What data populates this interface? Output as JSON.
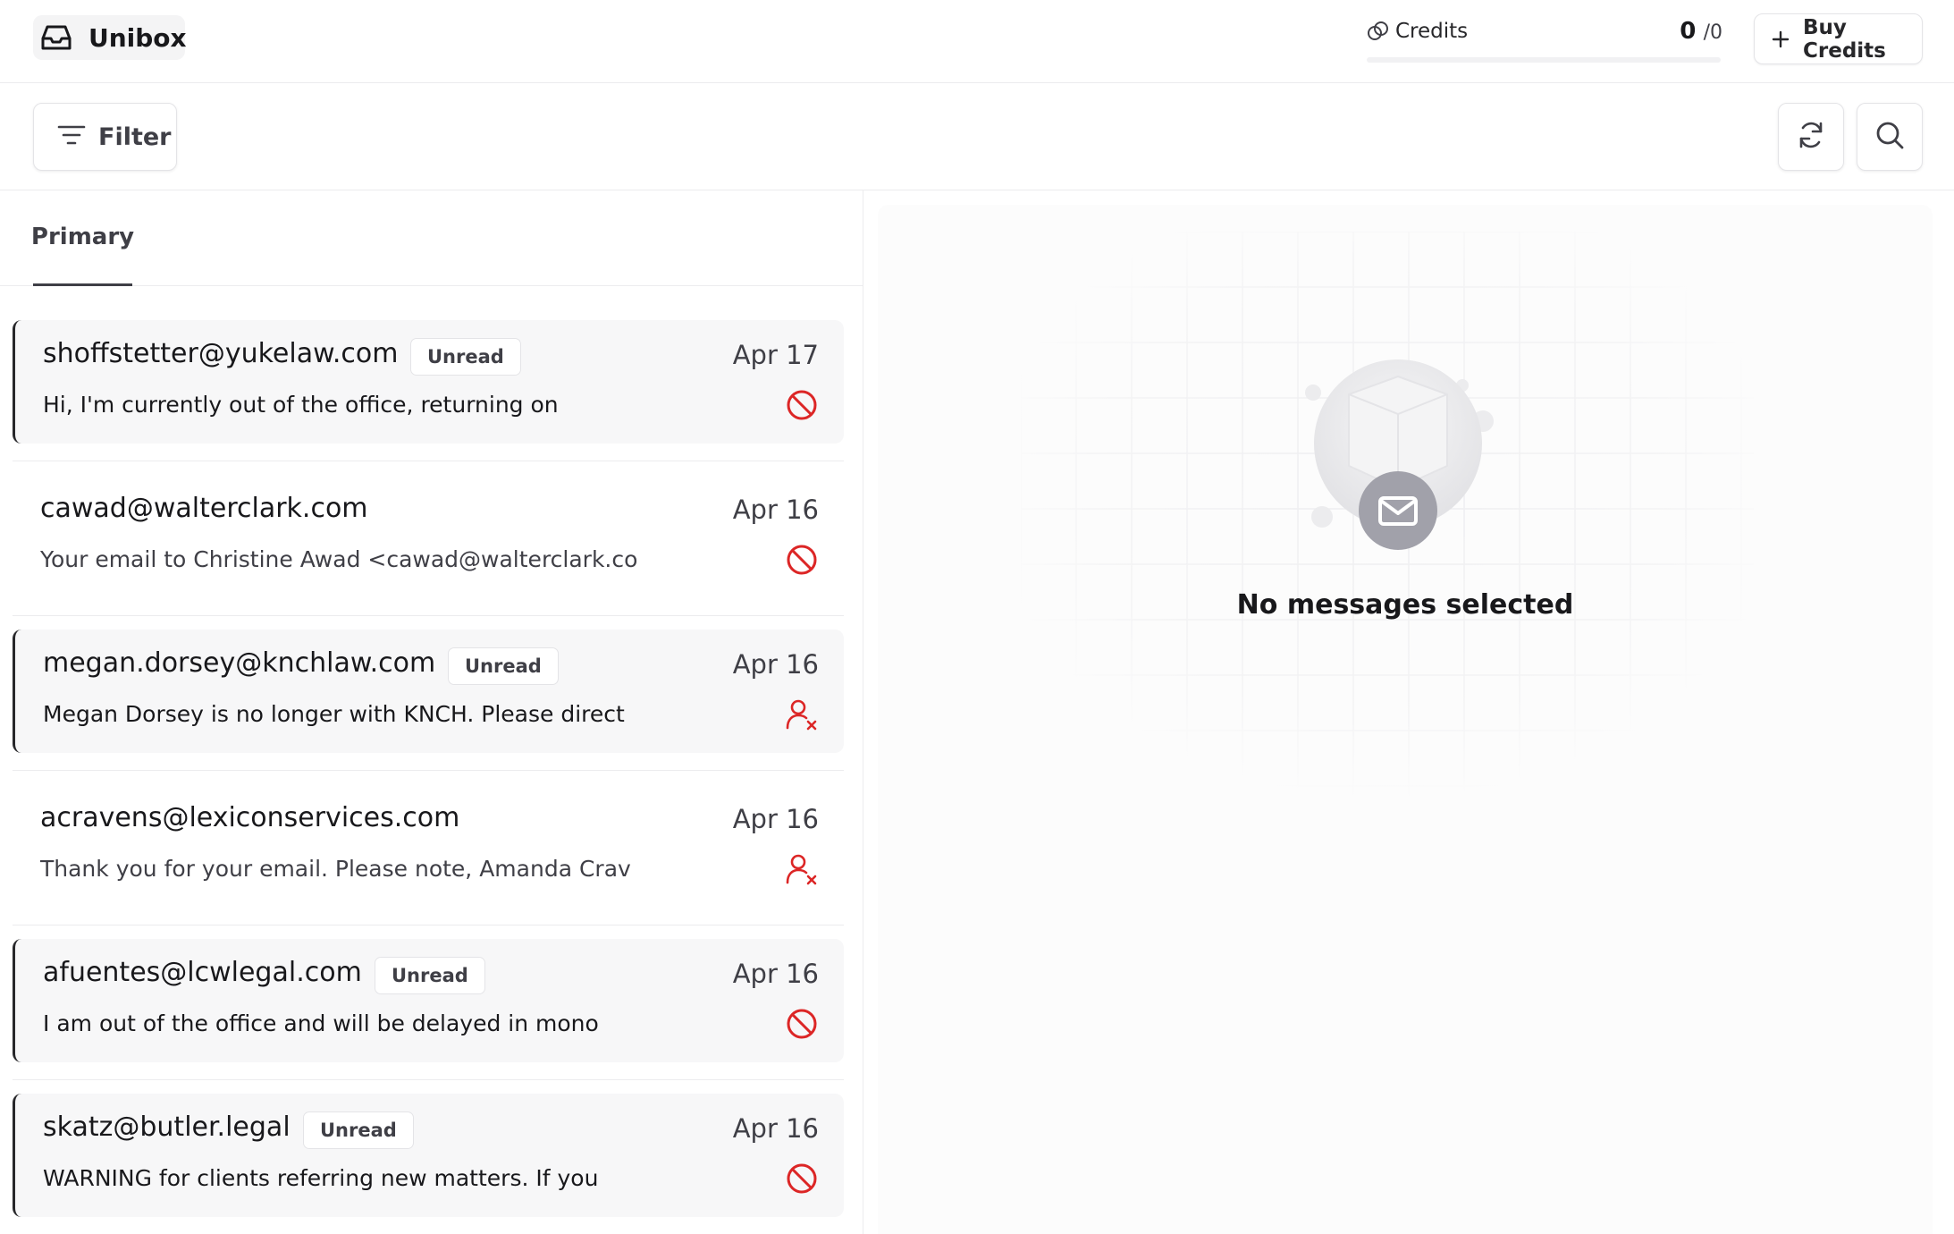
{
  "app": {
    "name": "Unibox",
    "icon": "inbox-icon"
  },
  "credits": {
    "label": "Credits",
    "used": "0",
    "total": "/0",
    "progress_fraction": 0,
    "icon": "coins-icon"
  },
  "buy_credits": {
    "label": "Buy Credits",
    "icon": "plus-icon"
  },
  "toolbar": {
    "filter_label": "Filter",
    "filter_icon": "filter-icon",
    "refresh_icon": "refresh-icon",
    "search_icon": "search-icon"
  },
  "tabs": [
    {
      "label": "Primary",
      "active": true
    }
  ],
  "messages": [
    {
      "sender": "shoffstetter@yukelaw.com",
      "badge": "Unread",
      "date": "Apr 17",
      "preview": "Hi, I'm currently out of the office, returning on",
      "status_icon": "blocked-icon",
      "unread": true
    },
    {
      "sender": "cawad@walterclark.com",
      "badge": "",
      "date": "Apr 16",
      "preview": "Your email to Christine Awad <cawad@walterclark.co",
      "status_icon": "blocked-icon",
      "unread": false
    },
    {
      "sender": "megan.dorsey@knchlaw.com",
      "badge": "Unread",
      "date": "Apr 16",
      "preview": "Megan Dorsey is no longer with KNCH. Please direct",
      "status_icon": "user-x-icon",
      "unread": true
    },
    {
      "sender": "acravens@lexiconservices.com",
      "badge": "",
      "date": "Apr 16",
      "preview": "Thank you for your email. Please note, Amanda Crav",
      "status_icon": "user-x-icon",
      "unread": false
    },
    {
      "sender": "afuentes@lcwlegal.com",
      "badge": "Unread",
      "date": "Apr 16",
      "preview": "I am out of the office and will be delayed in mono",
      "status_icon": "blocked-icon",
      "unread": true
    },
    {
      "sender": "skatz@butler.legal",
      "badge": "Unread",
      "date": "Apr 16",
      "preview": "WARNING for clients referring new matters. If you",
      "status_icon": "blocked-icon",
      "unread": true
    }
  ],
  "detail": {
    "empty_text": "No messages selected",
    "illustration_icon": "mail-icon"
  },
  "colors": {
    "status_red": "#dc2626",
    "accent_dark": "#27272a"
  }
}
